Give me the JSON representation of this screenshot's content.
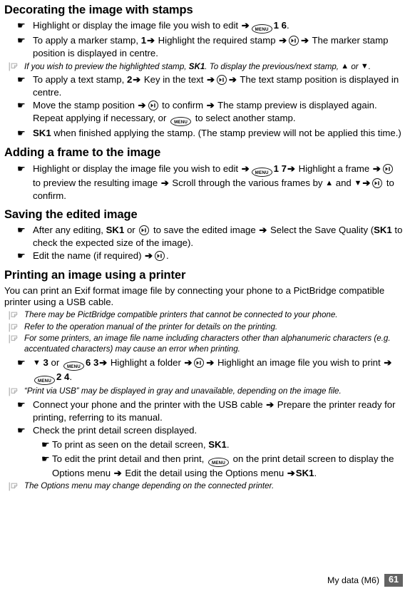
{
  "icons": {
    "bullet": "hand-pointing-icon",
    "note": "note-icon",
    "arrow": "arrow-right-icon",
    "menu_key": "menu-key-icon",
    "center_key": "center-select-key-icon",
    "up_triangle": "triangle-up-icon",
    "down_triangle": "triangle-down-icon"
  },
  "labels": {
    "menu_key_text": "MENU",
    "arrow_glyph": "➔",
    "hand_glyph": "☛",
    "up_glyph": "▲",
    "down_glyph": "▼"
  },
  "colors": {
    "text": "#000000",
    "note_icon": "#b3b3b3",
    "page_badge_bg": "#636363",
    "page_badge_text": "#ffffff"
  },
  "sections": [
    {
      "heading": "Decorating the image with stamps",
      "items": [
        {
          "type": "bullet",
          "parts": [
            {
              "t": "text",
              "v": "Highlight or display the image file you wish to edit "
            },
            {
              "t": "arrow"
            },
            {
              "t": "menu"
            },
            {
              "t": "bold",
              "v": "1 6"
            },
            {
              "t": "text",
              "v": "."
            }
          ]
        },
        {
          "type": "bullet",
          "parts": [
            {
              "t": "text",
              "v": "To apply a marker stamp, "
            },
            {
              "t": "bold",
              "v": "1"
            },
            {
              "t": "arrow"
            },
            {
              "t": "text",
              "v": " Highlight the required stamp "
            },
            {
              "t": "arrow"
            },
            {
              "t": "center"
            },
            {
              "t": "arrow"
            },
            {
              "t": "text",
              "v": " The marker stamp position is displayed in centre."
            }
          ]
        },
        {
          "type": "note",
          "parts": [
            {
              "t": "text",
              "v": "If you wish to preview the highlighted stamp, "
            },
            {
              "t": "bold",
              "v": "SK1"
            },
            {
              "t": "text",
              "v": ". To display the previous/next stamp, "
            },
            {
              "t": "up"
            },
            {
              "t": "text",
              "v": " or "
            },
            {
              "t": "down"
            },
            {
              "t": "text",
              "v": "."
            }
          ]
        },
        {
          "type": "bullet",
          "parts": [
            {
              "t": "text",
              "v": "To apply a text stamp, "
            },
            {
              "t": "bold",
              "v": "2"
            },
            {
              "t": "arrow"
            },
            {
              "t": "text",
              "v": " Key in the text "
            },
            {
              "t": "arrow"
            },
            {
              "t": "center"
            },
            {
              "t": "arrow"
            },
            {
              "t": "text",
              "v": " The text stamp position is displayed in centre."
            }
          ]
        },
        {
          "type": "bullet",
          "parts": [
            {
              "t": "text",
              "v": "Move the stamp position "
            },
            {
              "t": "arrow"
            },
            {
              "t": "center"
            },
            {
              "t": "text",
              "v": " to confirm "
            },
            {
              "t": "arrow"
            },
            {
              "t": "text",
              "v": " The stamp preview is displayed again. Repeat applying if necessary, or "
            },
            {
              "t": "menu"
            },
            {
              "t": "text",
              "v": " to select another stamp."
            }
          ]
        },
        {
          "type": "bullet",
          "parts": [
            {
              "t": "bold",
              "v": "SK1"
            },
            {
              "t": "text",
              "v": " when finished applying the stamp. (The stamp preview will not be applied this time.)"
            }
          ]
        }
      ]
    },
    {
      "heading": "Adding a frame to the image",
      "items": [
        {
          "type": "bullet",
          "parts": [
            {
              "t": "text",
              "v": "Highlight or display the image file you wish to edit "
            },
            {
              "t": "arrow"
            },
            {
              "t": "menu"
            },
            {
              "t": "bold",
              "v": "1 7"
            },
            {
              "t": "arrow"
            },
            {
              "t": "text",
              "v": " Highlight a frame "
            },
            {
              "t": "arrow"
            },
            {
              "t": "center"
            },
            {
              "t": "text",
              "v": " to preview the resulting image "
            },
            {
              "t": "arrow"
            },
            {
              "t": "text",
              "v": " Scroll through the various frames by "
            },
            {
              "t": "up"
            },
            {
              "t": "text",
              "v": " and "
            },
            {
              "t": "down"
            },
            {
              "t": "arrow"
            },
            {
              "t": "center"
            },
            {
              "t": "text",
              "v": " to confirm."
            }
          ]
        }
      ]
    },
    {
      "heading": "Saving the edited image",
      "items": [
        {
          "type": "bullet",
          "parts": [
            {
              "t": "text",
              "v": "After any editing, "
            },
            {
              "t": "bold",
              "v": "SK1"
            },
            {
              "t": "text",
              "v": " or "
            },
            {
              "t": "center"
            },
            {
              "t": "text",
              "v": " to save the edited image "
            },
            {
              "t": "arrow"
            },
            {
              "t": "text",
              "v": " Select the Save Quality ("
            },
            {
              "t": "bold",
              "v": "SK1"
            },
            {
              "t": "text",
              "v": " to check the expected size of the image)."
            }
          ]
        },
        {
          "type": "bullet",
          "parts": [
            {
              "t": "text",
              "v": "Edit the name (if required) "
            },
            {
              "t": "arrow"
            },
            {
              "t": "center"
            },
            {
              "t": "text",
              "v": "."
            }
          ]
        }
      ]
    },
    {
      "heading": "Printing an image using a printer",
      "intro": "You can print an Exif format image file by connecting your phone to a PictBridge compatible printer using a USB cable.",
      "items": [
        {
          "type": "note",
          "parts": [
            {
              "t": "text",
              "v": "There may be PictBridge compatible printers that cannot be connected to your phone."
            }
          ]
        },
        {
          "type": "note",
          "parts": [
            {
              "t": "text",
              "v": "Refer to the operation manual of the printer for details on the printing."
            }
          ]
        },
        {
          "type": "note",
          "parts": [
            {
              "t": "text",
              "v": "For some printers, an image file name including characters other than alphanumeric characters (e.g. accentuated characters) may cause an error when printing."
            }
          ]
        },
        {
          "type": "bullet",
          "parts": [
            {
              "t": "down"
            },
            {
              "t": "bold",
              "v": " 3"
            },
            {
              "t": "text",
              "v": " or "
            },
            {
              "t": "menu"
            },
            {
              "t": "bold",
              "v": "6 3"
            },
            {
              "t": "arrow"
            },
            {
              "t": "text",
              "v": " Highlight a folder "
            },
            {
              "t": "arrow"
            },
            {
              "t": "center"
            },
            {
              "t": "arrow"
            },
            {
              "t": "text",
              "v": " Highlight an image file you wish to print "
            },
            {
              "t": "arrow"
            },
            {
              "t": "menu"
            },
            {
              "t": "bold",
              "v": "2 4"
            },
            {
              "t": "text",
              "v": "."
            }
          ]
        },
        {
          "type": "note",
          "parts": [
            {
              "t": "text",
              "v": "“Print via USB” may be displayed in gray and unavailable, depending on the image file."
            }
          ]
        },
        {
          "type": "bullet",
          "parts": [
            {
              "t": "text",
              "v": "Connect your phone and the printer with the USB cable "
            },
            {
              "t": "arrow"
            },
            {
              "t": "text",
              "v": " Prepare the printer ready for printing, referring to its manual."
            }
          ]
        },
        {
          "type": "bullet",
          "parts": [
            {
              "t": "text",
              "v": "Check the print detail screen displayed."
            }
          ]
        },
        {
          "type": "subbullet",
          "parts": [
            {
              "t": "text",
              "v": "To print as seen on the detail screen, "
            },
            {
              "t": "bold",
              "v": "SK1"
            },
            {
              "t": "text",
              "v": "."
            }
          ]
        },
        {
          "type": "subbullet",
          "parts": [
            {
              "t": "text",
              "v": "To edit the print detail and then print, "
            },
            {
              "t": "menu"
            },
            {
              "t": "text",
              "v": " on the print detail screen to display the "
            },
            {
              "t": "break"
            },
            {
              "t": "text",
              "v": "Options menu "
            },
            {
              "t": "arrow"
            },
            {
              "t": "text",
              "v": " Edit the detail using the Options menu "
            },
            {
              "t": "arrow"
            },
            {
              "t": "bold",
              "v": "SK1"
            },
            {
              "t": "text",
              "v": "."
            }
          ]
        },
        {
          "type": "note",
          "parts": [
            {
              "t": "text",
              "v": "The Options menu may change depending on the connected printer."
            }
          ]
        }
      ]
    }
  ],
  "footer": {
    "caption": "My data (M6)",
    "page_number": "61"
  }
}
